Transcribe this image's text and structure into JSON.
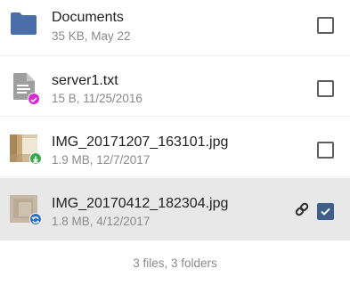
{
  "files": [
    {
      "name": "Documents",
      "meta": "35 KB, May 22",
      "type": "folder",
      "icon": "folder-icon",
      "checked": false
    },
    {
      "name": "server1.txt",
      "meta": "15 B, 11/25/2016",
      "type": "text",
      "icon": "text-file-icon",
      "badge": "shared-badge",
      "checked": false
    },
    {
      "name": "IMG_20171207_163101.jpg",
      "meta": "1.9 MB, 12/7/2017",
      "type": "image",
      "icon": "image-thumbnail",
      "badge": "downloaded-badge",
      "checked": false
    },
    {
      "name": "IMG_20170412_182304.jpg",
      "meta": "1.8 MB, 4/12/2017",
      "type": "image",
      "icon": "image-thumbnail",
      "badge": "sync-badge",
      "checked": true,
      "selected": true,
      "linked": true
    }
  ],
  "footer": "3 files, 3 folders",
  "colors": {
    "folder": "#4a6ea9",
    "shared_badge": "#d62bd0",
    "download_badge": "#3aa94e",
    "sync_badge": "#2a6fc4",
    "checkbox_on": "#3f5f88",
    "selected_row": "#e8e8e8"
  }
}
